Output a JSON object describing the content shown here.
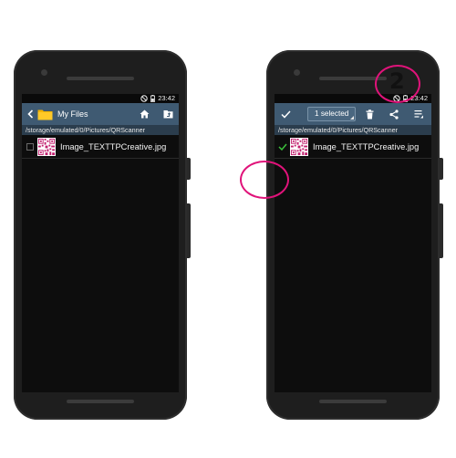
{
  "status_bar": {
    "time": "23:42"
  },
  "left_screen": {
    "title": "My Files",
    "path": "/storage/emulated/0/Pictures/QRScanner",
    "file_name": "Image_TEXTTPCreative.jpg"
  },
  "right_screen": {
    "selected_label": "1 selected",
    "path": "/storage/emulated/0/Pictures/QRScanner",
    "file_name": "Image_TEXTTPCreative.jpg"
  },
  "callouts": {
    "step_number": "2"
  },
  "colors": {
    "action_bar": "#3f5a72",
    "path_bar": "#2b3d4d",
    "folder": "#f5b400",
    "accent_check": "#3bbf3b",
    "callout": "#e0137a",
    "qr": "#c21f6e"
  },
  "icons": [
    "back-chevron-icon",
    "folder-icon",
    "home-icon",
    "folder-up-icon",
    "checkmark-icon",
    "delete-icon",
    "share-icon",
    "menu-icon",
    "qr-code-icon",
    "do-not-disturb-icon",
    "battery-icon"
  ]
}
